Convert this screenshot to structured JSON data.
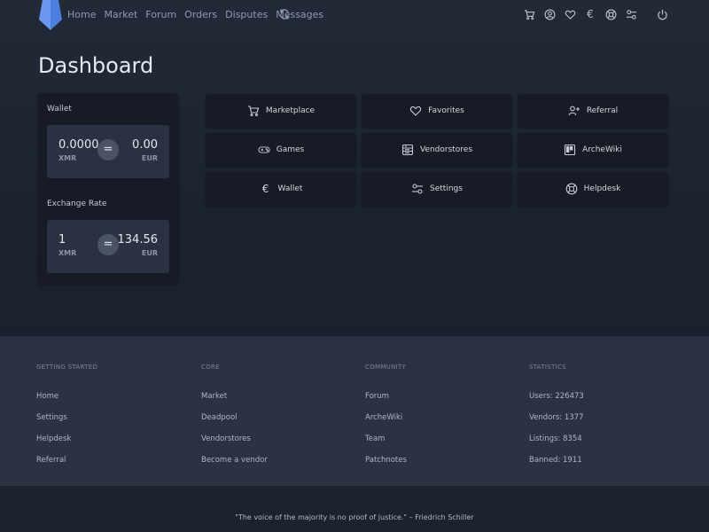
{
  "nav": {
    "links": [
      "Home",
      "Market",
      "Forum",
      "Orders",
      "Disputes",
      "Messages"
    ],
    "icons": [
      "cart-icon",
      "user-icon",
      "heart-icon",
      "euro-icon",
      "lifebuoy-icon",
      "toggles-icon",
      "power-icon"
    ],
    "euro_glyph": "€"
  },
  "page": {
    "title": "Dashboard"
  },
  "wallet": {
    "label": "Wallet",
    "left_value": "0.0000",
    "left_currency": "XMR",
    "right_value": "0.00",
    "right_currency": "EUR",
    "equals": "="
  },
  "exchange": {
    "label": "Exchange Rate",
    "left_value": "1",
    "left_currency": "XMR",
    "right_value": "134.56",
    "right_currency": "EUR",
    "equals": "="
  },
  "tiles": [
    {
      "label": "Marketplace",
      "icon": "cart-icon"
    },
    {
      "label": "Favorites",
      "icon": "heart-icon"
    },
    {
      "label": "Referral",
      "icon": "user-plus-icon"
    },
    {
      "label": "Games",
      "icon": "gamepad-icon"
    },
    {
      "label": "Vendorstores",
      "icon": "store-icon"
    },
    {
      "label": "ArcheWiki",
      "icon": "board-icon"
    },
    {
      "label": "Wallet",
      "icon": "euro-icon"
    },
    {
      "label": "Settings",
      "icon": "toggles-icon"
    },
    {
      "label": "Helpdesk",
      "icon": "lifebuoy-icon"
    }
  ],
  "tile_euro_glyph": "€",
  "footer": {
    "columns": [
      {
        "heading": "GETTING STARTED",
        "links": [
          "Home",
          "Settings",
          "Helpdesk",
          "Referral"
        ]
      },
      {
        "heading": "CORE",
        "links": [
          "Market",
          "Deadpool",
          "Vendorstores",
          "Become a vendor"
        ]
      },
      {
        "heading": "COMMUNITY",
        "links": [
          "Forum",
          "ArcheWiki",
          "Team",
          "Patchnotes"
        ]
      },
      {
        "heading": "STATISTICS",
        "links": [
          "Users: 226473",
          "Vendors: 1377",
          "Listings: 8354",
          "Banned: 1911"
        ]
      }
    ],
    "quote": "\"The voice of the majority is no proof of justice.\" – Friedrich Schiller"
  },
  "colors": {
    "background": "#1b2230",
    "card": "#161b26",
    "footer": "#2b3242",
    "logo": "#4d7fe0"
  }
}
